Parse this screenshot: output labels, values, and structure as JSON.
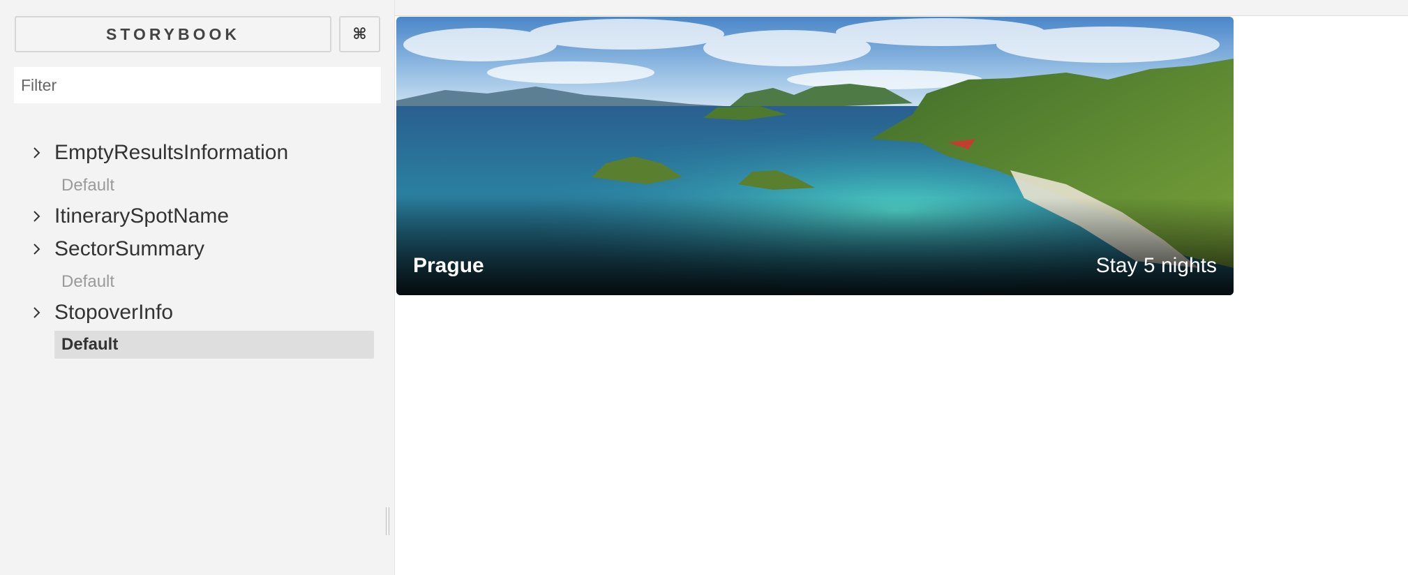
{
  "sidebar": {
    "brand_label": "STORYBOOK",
    "shortcut_icon": "command-icon",
    "shortcut_glyph": "⌘",
    "filter_placeholder": "Filter",
    "kinds": [
      {
        "name": "EmptyResultsInformation",
        "stories": [
          "Default"
        ]
      },
      {
        "name": "ItinerarySpotName",
        "stories": []
      },
      {
        "name": "SectorSummary",
        "stories": [
          "Default"
        ]
      },
      {
        "name": "StopoverInfo",
        "stories": [
          "Default"
        ],
        "selected_story": "Default"
      }
    ]
  },
  "preview": {
    "city": "Prague",
    "stay_text": "Stay 5 nights",
    "image": "tropical-bay-photo"
  },
  "colors": {
    "sidebar_bg": "#f3f3f3",
    "selected_bg": "#dedede",
    "story_text": "#9a9a9a"
  }
}
